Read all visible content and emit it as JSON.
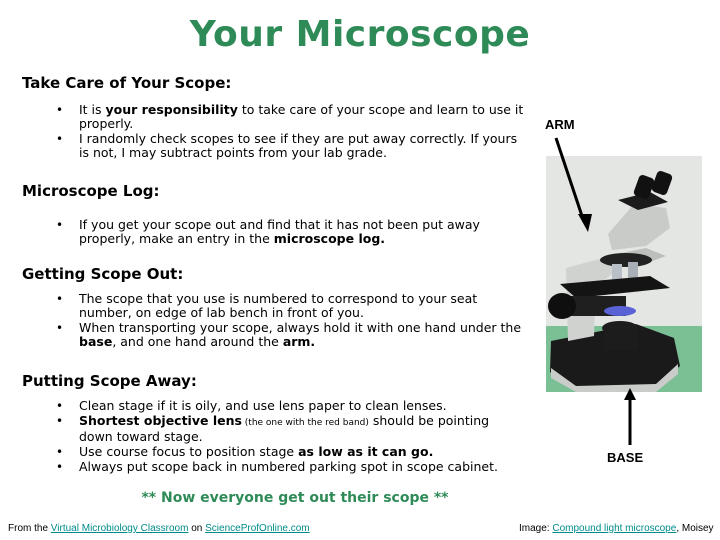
{
  "title": "Your Microscope",
  "colors": {
    "title": "#2e8b57",
    "link": "#008b8b"
  },
  "sections": [
    {
      "heading": "Take Care of Your Scope:",
      "items": [
        {
          "pre": "It is ",
          "bold": "your responsibility",
          "post": " to take care of your scope and learn to use it properly."
        },
        {
          "pre": "I randomly check scopes to see if they are put away correctly. If yours is not, I may subtract points from your lab grade.",
          "bold": "",
          "post": ""
        }
      ]
    },
    {
      "heading": "Microscope Log:",
      "items": [
        {
          "pre": "If you get your scope out and find that it has not been put away properly, make an entry in the ",
          "bold": "microscope log.",
          "post": ""
        }
      ]
    },
    {
      "heading": "Getting Scope Out:",
      "items": [
        {
          "pre": "The scope that you use is numbered to correspond to your seat number, on edge of lab bench in front of you.",
          "bold": "",
          "post": ""
        },
        {
          "pre": "When transporting your scope, always hold it with one hand under the ",
          "bold": "base",
          "post": ", and one hand around the ",
          "bold2": "arm.",
          "post2": ""
        }
      ]
    },
    {
      "heading": "Putting Scope Away:",
      "items": [
        {
          "pre": "Clean stage if it is oily, and use lens paper to clean lenses.",
          "bold": "",
          "post": ""
        },
        {
          "pre": "",
          "bold": "Shortest objective lens",
          "small": " (the one with the red band)",
          "post": " should be pointing down toward stage."
        },
        {
          "pre": "Use course focus to position stage ",
          "bold": "as low as it can go.",
          "post": ""
        },
        {
          "pre": "Always put scope back in numbered parking spot in scope cabinet.",
          "bold": "",
          "post": ""
        }
      ]
    }
  ],
  "figure": {
    "image": "compound-light-microscope-photo",
    "label_arm": "ARM",
    "label_base": "BASE"
  },
  "closing": "** Now everyone get out their scope **",
  "credits": {
    "left_pre": "From the ",
    "left_link1": "Virtual Microbiology Classroom",
    "left_mid": " on ",
    "left_link2": "ScienceProfOnline.com",
    "right_pre": "Image: ",
    "right_link": "Compound light microscope",
    "right_post": ", Moisey"
  }
}
